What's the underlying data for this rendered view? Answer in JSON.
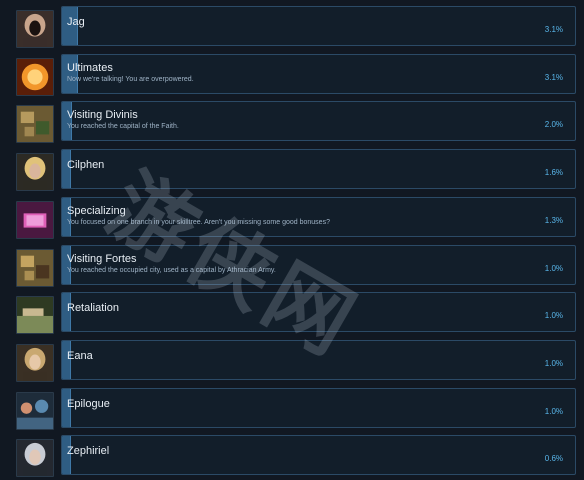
{
  "achievements": [
    {
      "title": "Jag",
      "description": "",
      "percent": "3.1%",
      "progress": 0.031,
      "icon": "portrait-dark-hair-icon",
      "colors": [
        "#3a2e2a",
        "#c9a58c",
        "#1a1210"
      ]
    },
    {
      "title": "Ultimates",
      "description": "Now we're talking! You are overpowered.",
      "percent": "3.1%",
      "progress": 0.031,
      "icon": "fire-orb-icon",
      "colors": [
        "#5a1e08",
        "#f2962a",
        "#ffd27a"
      ]
    },
    {
      "title": "Visiting Divinis",
      "description": "You reached the capital of the Faith.",
      "percent": "2.0%",
      "progress": 0.02,
      "icon": "city-map-icon",
      "colors": [
        "#6b5a33",
        "#b69a5e",
        "#3f5a2c"
      ]
    },
    {
      "title": "Cilphen",
      "description": "",
      "percent": "1.6%",
      "progress": 0.016,
      "icon": "portrait-blonde-icon",
      "colors": [
        "#2c2a24",
        "#e0c27a",
        "#d9b59c"
      ]
    },
    {
      "title": "Specializing",
      "description": "You focused on one branch in your skilltree. Aren't you missing some good bonuses?",
      "percent": "1.3%",
      "progress": 0.013,
      "icon": "spellbook-icon",
      "colors": [
        "#4a1840",
        "#e060b8",
        "#f4b8e8"
      ]
    },
    {
      "title": "Visiting Fortes",
      "description": "You reached the occupied city, used as a capital by Athracian Army.",
      "percent": "1.0%",
      "progress": 0.01,
      "icon": "city-map-icon",
      "colors": [
        "#6b5a33",
        "#c4a460",
        "#4a3520"
      ]
    },
    {
      "title": "Retaliation",
      "description": "",
      "percent": "1.0%",
      "progress": 0.01,
      "icon": "landscape-icon",
      "colors": [
        "#2e3a22",
        "#7c8a58",
        "#c8b890"
      ]
    },
    {
      "title": "Eana",
      "description": "",
      "percent": "1.0%",
      "progress": 0.01,
      "icon": "portrait-long-hair-icon",
      "colors": [
        "#3a3024",
        "#c9a870",
        "#e6c8a8"
      ]
    },
    {
      "title": "Epilogue",
      "description": "",
      "percent": "1.0%",
      "progress": 0.01,
      "icon": "group-portrait-icon",
      "colors": [
        "#1e2c3a",
        "#5a8ab0",
        "#d09070"
      ]
    },
    {
      "title": "Zephiriel",
      "description": "",
      "percent": "0.6%",
      "progress": 0.006,
      "icon": "portrait-silver-hair-icon",
      "colors": [
        "#242830",
        "#c8ccd4",
        "#e0c8b8"
      ]
    }
  ],
  "watermark": "游侠网"
}
